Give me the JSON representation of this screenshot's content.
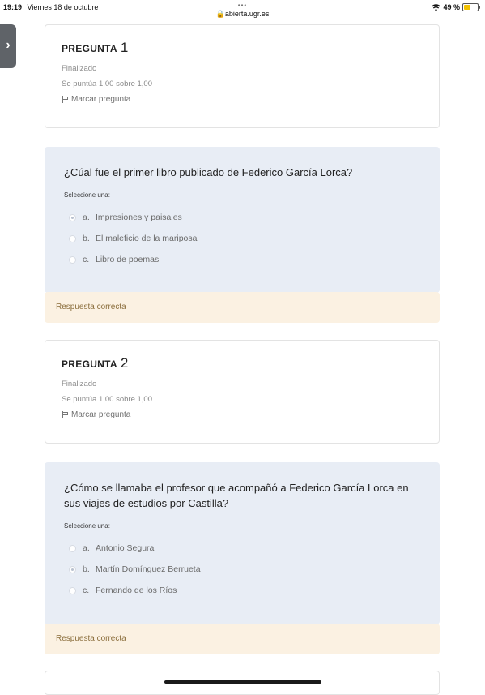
{
  "status_bar": {
    "time": "19:19",
    "date": "Viernes 18 de octubre",
    "dots": "•••",
    "url": "abierta.ugr.es",
    "battery": "49 %",
    "battery_color": "#f2c200"
  },
  "drawer_toggle": {
    "icon": "chevron-right-icon",
    "glyph": "›"
  },
  "questions": [
    {
      "label": "PREGUNTA",
      "number": "1",
      "state": "Finalizado",
      "grade": "Se puntúa 1,00 sobre 1,00",
      "flag_label": "Marcar pregunta",
      "text": "¿Cúal fue el primer libro publicado de Federico García Lorca?",
      "prompt": "Seleccione una:",
      "options": [
        {
          "letter": "a.",
          "text": "Impresiones y paisajes",
          "checked": true
        },
        {
          "letter": "b.",
          "text": "El maleficio de la mariposa",
          "checked": false
        },
        {
          "letter": "c.",
          "text": "Libro de poemas",
          "checked": false
        }
      ],
      "feedback": "Respuesta correcta"
    },
    {
      "label": "PREGUNTA",
      "number": "2",
      "state": "Finalizado",
      "grade": "Se puntúa 1,00 sobre 1,00",
      "flag_label": "Marcar pregunta",
      "text": "¿Cómo se llamaba el profesor que acompañó a Federico García Lorca en sus viajes de estudios por Castilla?",
      "prompt": "Seleccione una:",
      "options": [
        {
          "letter": "a.",
          "text": "Antonio Segura",
          "checked": false
        },
        {
          "letter": "b.",
          "text": "Martín Domínguez Berrueta",
          "checked": true
        },
        {
          "letter": "c.",
          "text": "Fernando de los Ríos",
          "checked": false
        }
      ],
      "feedback": "Respuesta correcta"
    }
  ],
  "colors": {
    "formulation_bg": "#e8edf5",
    "feedback_bg": "#fbf1e2",
    "feedback_text": "#8a6d3b"
  }
}
